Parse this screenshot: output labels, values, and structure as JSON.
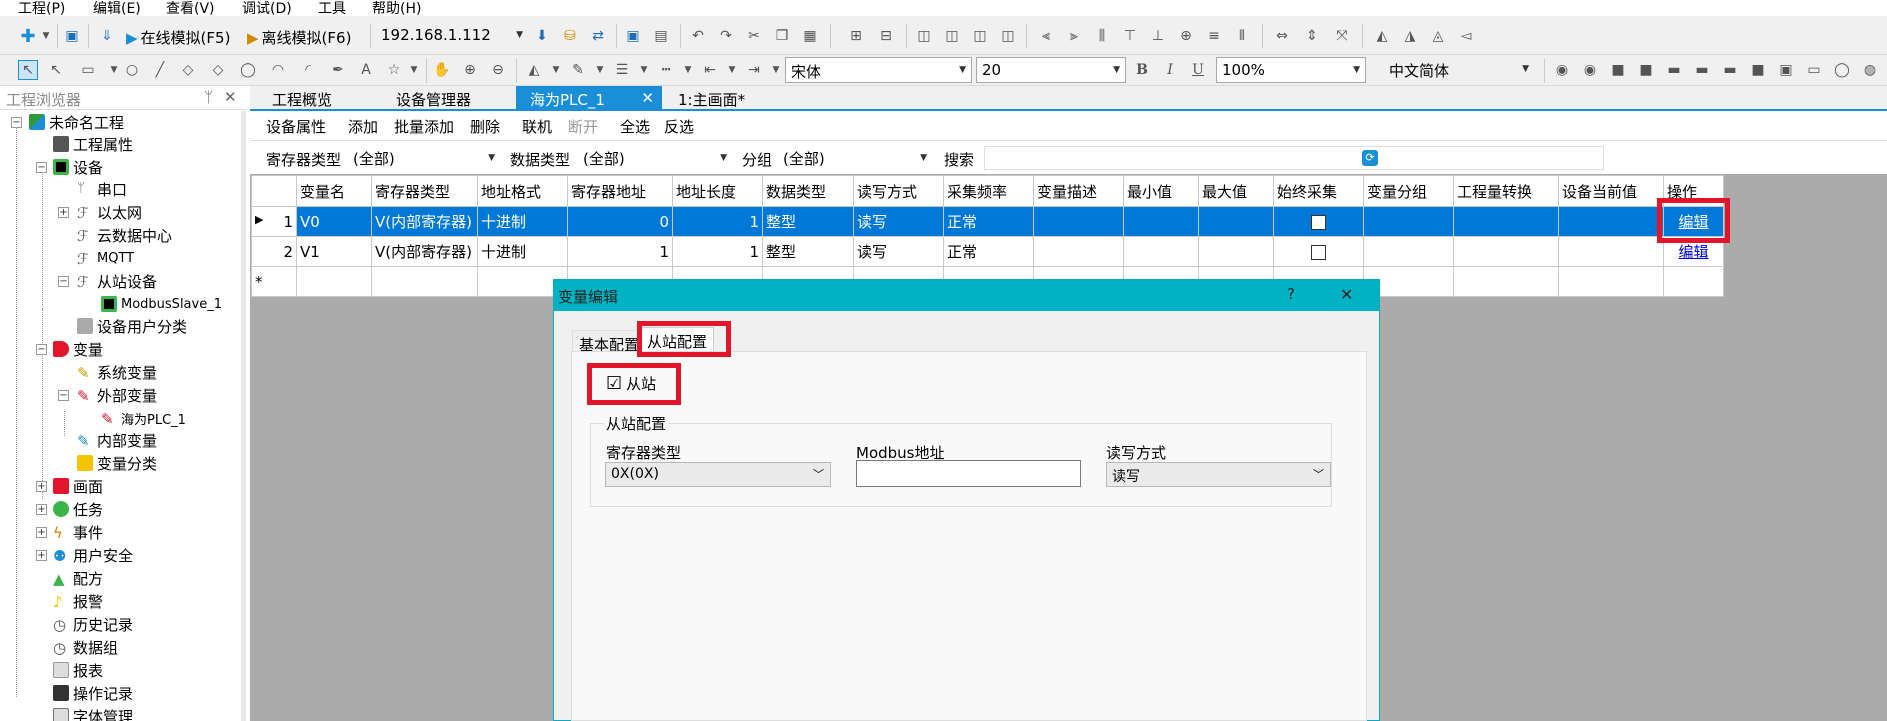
{
  "menu": [
    "工程(P)",
    "编辑(E)",
    "查看(V)",
    "调试(D)",
    "工具",
    "帮助(H)"
  ],
  "toolbar": {
    "online_sim": "在线模拟(F5)",
    "offline_sim": "离线模拟(F6)",
    "ip_address": "192.168.1.112",
    "font_name": "宋体",
    "font_size": "20",
    "zoom": "100%",
    "language": "中文简体",
    "bold": "B",
    "italic": "I",
    "underline": "U"
  },
  "explorer": {
    "title": "工程浏览器",
    "pin": "ᛘ",
    "close": "✕",
    "items": {
      "root": "未命名工程",
      "project_props": "工程属性",
      "device": "设备",
      "serial": "串口",
      "ethernet": "以太网",
      "cloud": "云数据中心",
      "mqtt": "MQTT",
      "slave": "从站设备",
      "modbus_slave": "ModbusSlave_1",
      "device_user_cat": "设备用户分类",
      "variable": "变量",
      "sys_var": "系统变量",
      "ext_var": "外部变量",
      "plc": "海为PLC_1",
      "int_var": "内部变量",
      "var_cat": "变量分类",
      "screen": "画面",
      "task": "任务",
      "event": "事件",
      "user_security": "用户安全",
      "recipe": "配方",
      "alarm": "报警",
      "history": "历史记录",
      "data_group": "数据组",
      "report": "报表",
      "op_log": "操作记录",
      "font_mgr": "字体管理"
    }
  },
  "tabs": [
    "工程概览",
    "设备管理器",
    "海为PLC_1",
    "1:主画面*"
  ],
  "commands": [
    "设备属性",
    "添加",
    "批量添加",
    "删除",
    "联机",
    "断开",
    "全选",
    "反选"
  ],
  "filters": {
    "reg_type_label": "寄存器类型",
    "reg_type_value": "(全部)",
    "data_type_label": "数据类型",
    "data_type_value": "(全部)",
    "group_label": "分组",
    "group_value": "(全部)",
    "search_label": "搜索"
  },
  "table": {
    "columns": [
      "变量名",
      "寄存器类型",
      "地址格式",
      "寄存器地址",
      "地址长度",
      "数据类型",
      "读写方式",
      "采集频率",
      "变量描述",
      "最小值",
      "最大值",
      "始终采集",
      "变量分组",
      "工程量转换",
      "设备当前值",
      "操作"
    ],
    "rows": [
      {
        "idx": "1",
        "name": "V0",
        "reg": "V(内部寄存器)",
        "fmt": "十进制",
        "addr": "0",
        "len": "1",
        "dtype": "整型",
        "rw": "读写",
        "freq": "正常",
        "action": "编辑"
      },
      {
        "idx": "2",
        "name": "V1",
        "reg": "V(内部寄存器)",
        "fmt": "十进制",
        "addr": "1",
        "len": "1",
        "dtype": "整型",
        "rw": "读写",
        "freq": "正常",
        "action": "编辑"
      }
    ],
    "new_row_marker": "*",
    "current_row_marker": "▶"
  },
  "dialog": {
    "title": "变量编辑",
    "help": "?",
    "close": "✕",
    "tab_basic": "基本配置",
    "tab_slave": "从站配置",
    "slave_checkbox_label": "从站",
    "slave_checkbox_mark": "☑",
    "group_title": "从站配置",
    "reg_type_label": "寄存器类型",
    "reg_type_value": "0X(0X)",
    "modbus_addr_label": "Modbus地址",
    "modbus_addr_value": "",
    "rw_label": "读写方式",
    "rw_value": "读写"
  },
  "colors": {
    "accent": "#0078d7",
    "tab_active": "#1a8fd8",
    "dialog_title": "#00b3c4",
    "highlight_red": "#e3152b"
  }
}
